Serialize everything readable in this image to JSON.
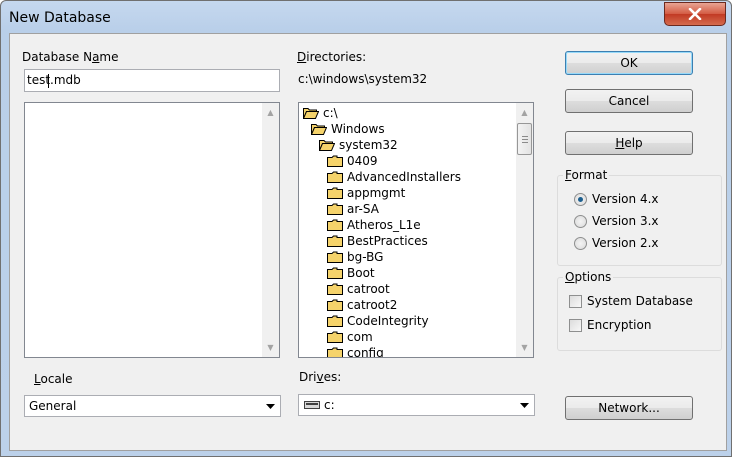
{
  "window": {
    "title": "New Database"
  },
  "database_name": {
    "label": "Database Name",
    "label_pre": "Database N",
    "label_key": "a",
    "label_post": "me",
    "value": "test.mdb"
  },
  "directories": {
    "label_key": "D",
    "label_rest": "irectories:",
    "current_path": "c:\\windows\\system32",
    "items": [
      {
        "name": "c:\\",
        "icon": "open-folder-icon",
        "indent": 0
      },
      {
        "name": "Windows",
        "icon": "open-folder-icon",
        "indent": 1
      },
      {
        "name": "system32",
        "icon": "open-folder-icon",
        "indent": 2
      },
      {
        "name": "0409",
        "icon": "folder-icon",
        "indent": 3
      },
      {
        "name": "AdvancedInstallers",
        "icon": "folder-icon",
        "indent": 3
      },
      {
        "name": "appmgmt",
        "icon": "folder-icon",
        "indent": 3
      },
      {
        "name": "ar-SA",
        "icon": "folder-icon",
        "indent": 3
      },
      {
        "name": "Atheros_L1e",
        "icon": "folder-icon",
        "indent": 3
      },
      {
        "name": "BestPractices",
        "icon": "folder-icon",
        "indent": 3
      },
      {
        "name": "bg-BG",
        "icon": "folder-icon",
        "indent": 3
      },
      {
        "name": "Boot",
        "icon": "folder-icon",
        "indent": 3
      },
      {
        "name": "catroot",
        "icon": "folder-icon",
        "indent": 3
      },
      {
        "name": "catroot2",
        "icon": "folder-icon",
        "indent": 3
      },
      {
        "name": "CodeIntegrity",
        "icon": "folder-icon",
        "indent": 3
      },
      {
        "name": "com",
        "icon": "folder-icon",
        "indent": 3
      },
      {
        "name": "config",
        "icon": "folder-icon",
        "indent": 3
      }
    ]
  },
  "buttons": {
    "ok": "OK",
    "cancel": "Cancel",
    "help_key": "H",
    "help_rest": "elp",
    "network": "Network..."
  },
  "format": {
    "title_key": "F",
    "title_rest": "ormat",
    "options": [
      "Version 4.x",
      "Version 3.x",
      "Version 2.x"
    ],
    "selected": "Version 4.x"
  },
  "options": {
    "title_key": "O",
    "title_rest": "ptions",
    "system_database": "System Database",
    "encryption": "Encryption"
  },
  "locale": {
    "label_key": "L",
    "label_rest": "ocale",
    "value": "General"
  },
  "drives": {
    "label_pre": "Dri",
    "label_key": "v",
    "label_post": "es:",
    "value": "c:"
  },
  "colors": {
    "dialog_bg": "#f0f0f0",
    "title_bar": "#bcd1ea",
    "close_red": "#c13a24",
    "radio_dot": "#1d5f8e",
    "folder_yellow": "#f5d36b"
  }
}
